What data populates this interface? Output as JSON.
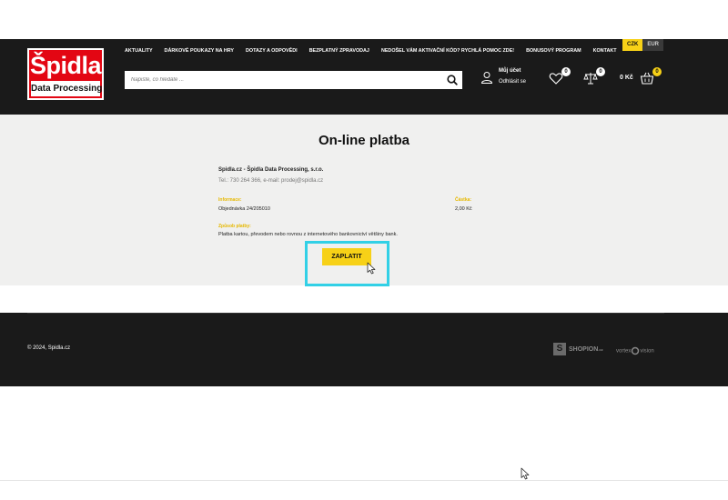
{
  "header": {
    "logo": {
      "top": "Špidla",
      "bottom": "Data Processing"
    },
    "nav": [
      "AKTUALITY",
      "DÁRKOVÉ POUKAZY NA HRY",
      "DOTAZY A ODPOVĚDI",
      "BEZPLATNÝ ZPRAVODAJ",
      "NEDOŠEL VÁM AKTIVAČNÍ KÓD? RYCHLÁ POMOC ZDE!",
      "BONUSOVÝ PROGRAM",
      "KONTAKT"
    ],
    "currency": {
      "active": "CZK",
      "inactive": "EUR"
    },
    "search": {
      "placeholder": "Napište, co hledáte ..."
    },
    "account": {
      "title": "Můj účet",
      "logout": "Odhlásit se"
    },
    "wishlist_count": "0",
    "compare_count": "0",
    "cart": {
      "price": "0 Kč",
      "count": "0"
    }
  },
  "main": {
    "title": "On-line platba",
    "company": "Spidla.cz - Špidla Data Processing, s.r.o.",
    "contact": "Tel.: 730 264 366, e-mail: prodej@spidla.cz",
    "info_label": "Informace:",
    "info_value": "Objednávka 24/205010",
    "amount_label": "Částka:",
    "amount_value": "2,00 Kč",
    "method_label": "Způsob platby:",
    "method_value": "Platba kartou, převodem nebo rovnou z internetového bankovnictví většiny bank.",
    "pay_button": "ZAPLATIT"
  },
  "footer": {
    "copyright": "© 2024, Spidla.cz",
    "shopion": "SHOPION",
    "shopion_suffix": ".cz",
    "vortex": "vortex",
    "vision": "vision"
  },
  "colors": {
    "accent": "#f7d117",
    "header_bg": "#1a1a1a",
    "logo_red": "#e30613",
    "highlight": "#32d0e6"
  }
}
